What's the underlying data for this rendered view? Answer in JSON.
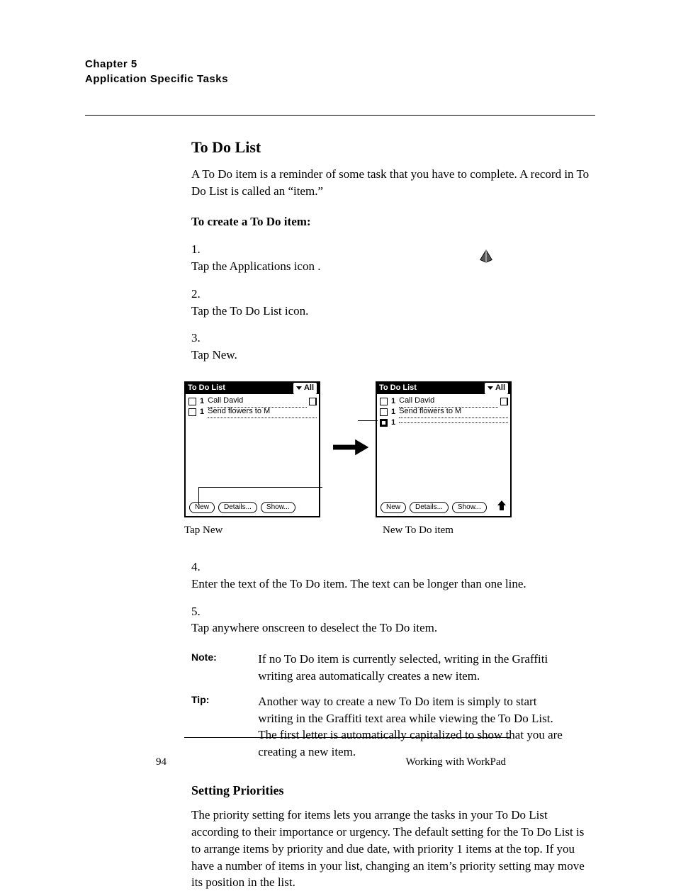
{
  "chapter_label": "Chapter 5",
  "chapter_title": "Application Specific Tasks",
  "todo": {
    "heading": "To Do List",
    "intro": "A To Do item is a reminder of some task that you have to complete. A record in To Do List is called an “item.”",
    "steps": {
      "create_title": "To create a To Do item:",
      "s1": "Tap the Applications icon        .",
      "s2": "Tap the To Do List icon.",
      "s3": "Tap New.",
      "s4": "Enter the text of the To Do item. The text can be longer than one line.",
      "s5": "Tap anywhere onscreen to deselect the To Do item."
    }
  },
  "note": {
    "label": "Note:",
    "body": "If no To Do item is currently selected, writing in the Graffiti writing area automatically creates a new item."
  },
  "tip": {
    "label": "Tip:",
    "body": "Another way to create a new To Do item is simply to start writing in the Graffiti text area while viewing the To Do List. The first letter is automatically capitalized to show that you are creating a new item."
  },
  "pri": {
    "heading": "Setting Priorities",
    "p1": "The priority setting for items lets you arrange the tasks in your To Do List according to their importance or urgency. The default setting for the To Do List is to arrange items by priority and due date, with priority 1 items at the top. If you have a number of items in your list, changing an item’s priority setting may move its position in the list."
  },
  "palm": {
    "title": "To Do List",
    "category": "All",
    "btn_new": "New",
    "btn_details": "Details...",
    "btn_show": "Show...",
    "items": {
      "a": {
        "pri": "1",
        "text": "Call David"
      },
      "b": {
        "pri": "1",
        "text": "Send flowers to M"
      },
      "c": {
        "pri": "1",
        "text": ""
      }
    }
  },
  "callouts": {
    "new_btn": "Tap New",
    "new_item": "New To Do item"
  },
  "footer": {
    "page_no": "94",
    "section": "Working with WorkPad"
  }
}
